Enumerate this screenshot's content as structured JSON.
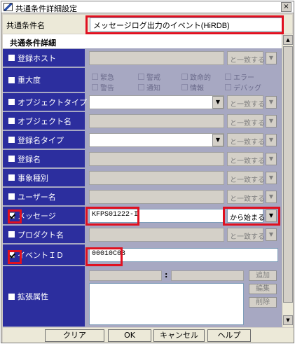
{
  "window": {
    "title": "共通条件詳細設定",
    "close_glyph": "×"
  },
  "name_field": {
    "label": "共通条件名",
    "value": "メッセージログ出力のイベント(HiRDB)"
  },
  "section": {
    "title": "共通条件詳細"
  },
  "rows": {
    "host": {
      "label": "登録ホスト",
      "checked": false,
      "match": "と一致する"
    },
    "severity": {
      "label": "重大度",
      "checked": false,
      "options": [
        "緊急",
        "警戒",
        "致命的",
        "エラー",
        "警告",
        "通知",
        "情報",
        "デバッグ"
      ]
    },
    "object_type": {
      "label": "オブジェクトタイプ",
      "checked": false,
      "match": "と一致する"
    },
    "object_name": {
      "label": "オブジェクト名",
      "checked": false,
      "match": "と一致する"
    },
    "reg_name_type": {
      "label": "登録名タイプ",
      "checked": false,
      "match": "と一致する"
    },
    "reg_name": {
      "label": "登録名",
      "checked": false,
      "match": "と一致する"
    },
    "event_type": {
      "label": "事象種別",
      "checked": false,
      "match": "と一致する"
    },
    "user_name": {
      "label": "ユーザー名",
      "checked": false,
      "match": "と一致する"
    },
    "message": {
      "label": "メッセージ",
      "checked": true,
      "value": "KFPS01222-I",
      "match": "から始まる"
    },
    "product_name": {
      "label": "プロダクト名",
      "checked": false,
      "match": "と一致する"
    },
    "event_id": {
      "label": "イベントＩＤ",
      "checked": true,
      "value": "00010C03"
    },
    "ext_attr": {
      "label": "拡張属性",
      "checked": false,
      "colon": ":",
      "add": "追加",
      "edit": "編集",
      "delete": "削除"
    }
  },
  "buttons": {
    "clear": "クリア",
    "ok": "OK",
    "cancel": "キャンセル",
    "help": "ヘルプ"
  },
  "colors": {
    "label_bg": "#2c2e9e",
    "panel_bg": "#a7a8c2",
    "highlight": "#e01020"
  }
}
